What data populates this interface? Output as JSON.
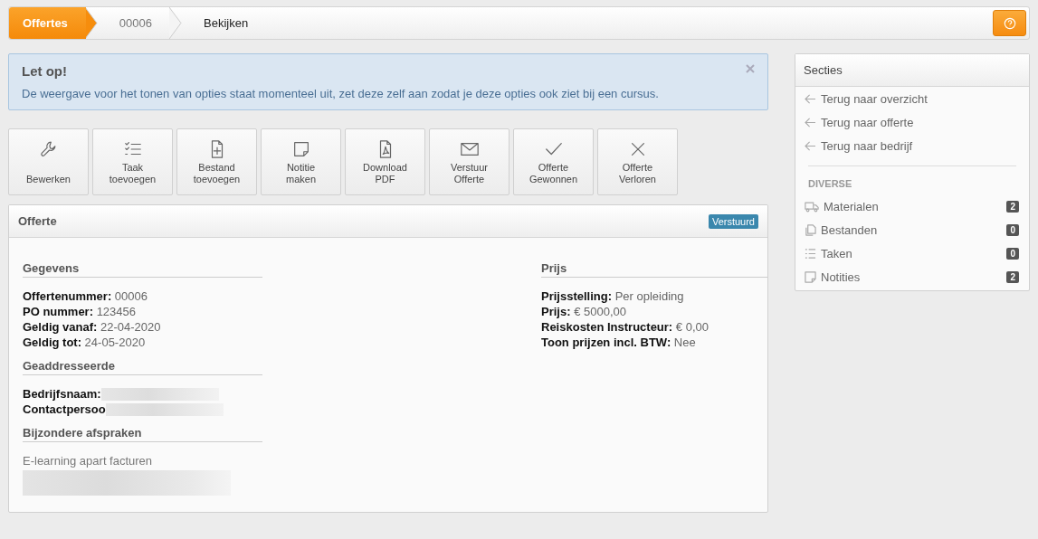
{
  "breadcrumb": {
    "items": [
      {
        "label": "Offertes",
        "kind": "home"
      },
      {
        "label": "00006",
        "kind": "link"
      },
      {
        "label": "Bekijken",
        "kind": "current"
      }
    ]
  },
  "alert": {
    "title": "Let op!",
    "message": "De weergave voor het tonen van opties staat momenteel uit, zet deze zelf aan zodat je deze opties ook ziet bij een cursus."
  },
  "actions": [
    {
      "label": "Bewerken",
      "kind": "edit"
    },
    {
      "label": "Taak toevoegen",
      "kind": "task"
    },
    {
      "label": "Bestand toevoegen",
      "kind": "file"
    },
    {
      "label": "Notitie maken",
      "kind": "note"
    },
    {
      "label": "Download PDF",
      "kind": "pdf"
    },
    {
      "label": "Verstuur Offerte",
      "kind": "mail"
    },
    {
      "label": "Offerte Gewonnen",
      "kind": "won"
    },
    {
      "label": "Offerte Verloren",
      "kind": "lost"
    }
  ],
  "panel": {
    "title": "Offerte",
    "badge": "Verstuurd",
    "columns": [
      {
        "sections": [
          {
            "title": "Gegevens",
            "rows": [
              {
                "kind": "field",
                "label": "Offertenummer:",
                "value": "00006"
              },
              {
                "kind": "field",
                "label": "PO nummer:",
                "value": "123456"
              },
              {
                "kind": "field",
                "label": "Geldig vanaf:",
                "value": "22-04-2020"
              },
              {
                "kind": "field",
                "label": "Geldig tot:",
                "value": "24-05-2020"
              }
            ]
          },
          {
            "title": "Geaddresseerde",
            "rows": [
              {
                "kind": "redacted-field",
                "label": "Bedrijfsnaam:"
              },
              {
                "kind": "redacted-field",
                "label": "Contactpersoo"
              }
            ]
          },
          {
            "title": "Bijzondere afspraken",
            "rows": [
              {
                "kind": "text",
                "value": "E-learning apart facturen"
              },
              {
                "kind": "redacted"
              }
            ]
          }
        ]
      },
      {
        "sections": [
          {
            "title": "Prijs",
            "rows": [
              {
                "kind": "field",
                "label": "Prijsstelling:",
                "value": "Per opleiding"
              },
              {
                "kind": "field",
                "label": "Prijs:",
                "value": "€ 5000,00"
              },
              {
                "kind": "field",
                "label": "Reiskosten Instructeur:",
                "value": "€ 0,00"
              },
              {
                "kind": "field",
                "label": "Toon prijzen incl. BTW:",
                "value": "Nee"
              }
            ]
          }
        ]
      }
    ]
  },
  "sidebar": {
    "title": "Secties",
    "links": [
      {
        "label": "Terug naar overzicht"
      },
      {
        "label": "Terug naar offerte"
      },
      {
        "label": "Terug naar bedrijf"
      }
    ],
    "group": "DIVERSE",
    "items": [
      {
        "label": "Materialen",
        "count": "2",
        "kind": "materials"
      },
      {
        "label": "Bestanden",
        "count": "0",
        "kind": "files"
      },
      {
        "label": "Taken",
        "count": "0",
        "kind": "tasks"
      },
      {
        "label": "Notities",
        "count": "2",
        "kind": "notes"
      }
    ]
  }
}
